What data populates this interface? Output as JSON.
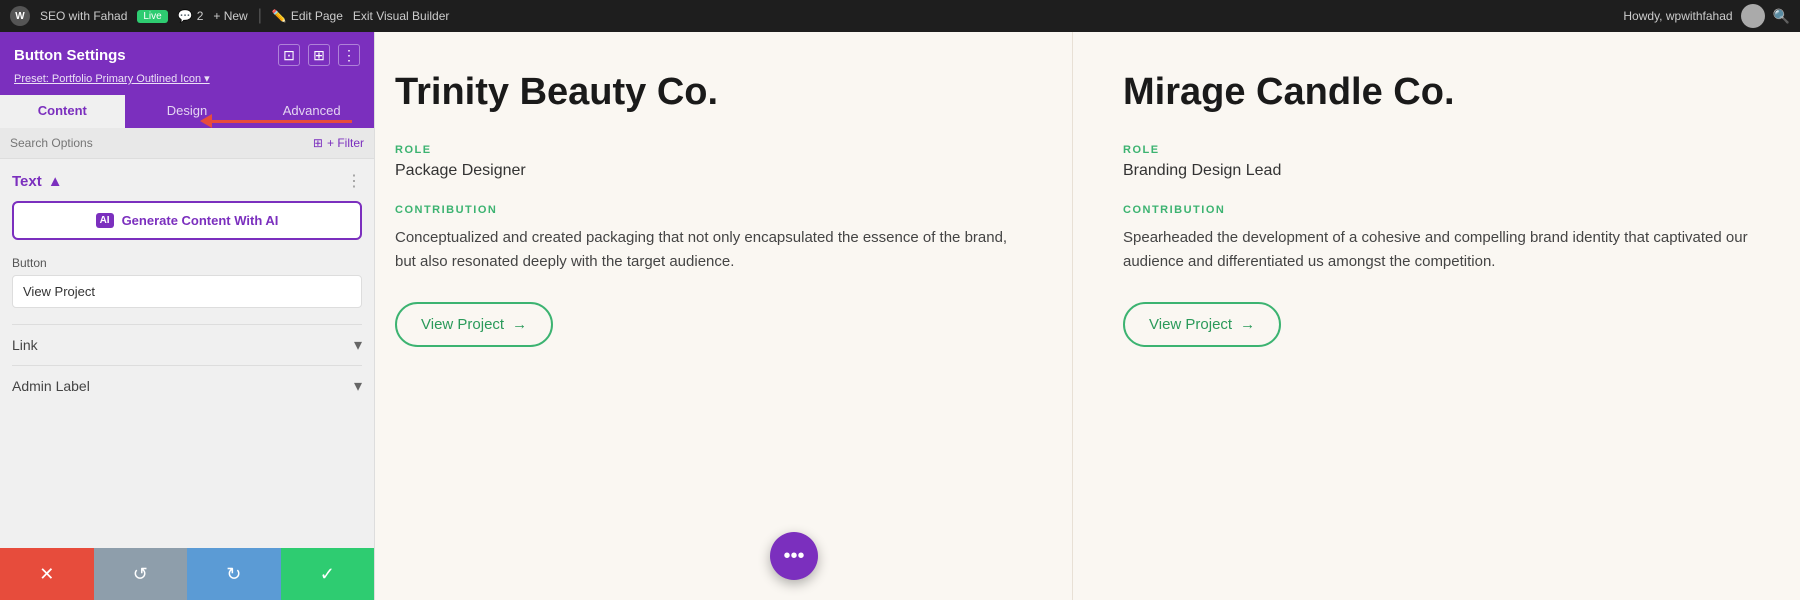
{
  "admin_bar": {
    "site_name": "SEO with Fahad",
    "live_badge": "Live",
    "comments_count": "2",
    "edit_page": "Edit Page",
    "exit_builder": "Exit Visual Builder",
    "new_label": "+ New",
    "user_greeting": "Howdy, wpwithfahad",
    "search_icon": "search-icon"
  },
  "panel": {
    "title": "Button Settings",
    "preset_label": "Preset: Portfolio Primary Outlined Icon ▾",
    "tabs": [
      "Content",
      "Design",
      "Advanced"
    ],
    "active_tab": "Content",
    "search_placeholder": "Search Options",
    "filter_label": "+ Filter",
    "text_section_title": "Text",
    "ai_button_label": "Generate Content With AI",
    "ai_badge": "AI",
    "button_section_label": "Button",
    "button_input_value": "View Project",
    "link_section": "Link",
    "admin_label_section": "Admin Label"
  },
  "bottom_bar": {
    "cancel_icon": "✕",
    "undo_icon": "↺",
    "redo_icon": "↻",
    "save_icon": "✓"
  },
  "cards": [
    {
      "title": "Trinity Beauty Co.",
      "role_label": "ROLE",
      "role_value": "Package Designer",
      "contribution_label": "CONTRIBUTION",
      "contribution_text": "Conceptualized and created packaging that not only encapsulated the essence of the brand, but also resonated deeply with the target audience.",
      "button_label": "View Project",
      "button_arrow": "→"
    },
    {
      "title": "Mirage Candle Co.",
      "role_label": "ROLE",
      "role_value": "Branding Design Lead",
      "contribution_label": "CONTRIBUTION",
      "contribution_text": "Spearheaded the development of a cohesive and compelling brand identity that captivated our audience and differentiated us amongst the competition.",
      "button_label": "View Project",
      "button_arrow": "→"
    }
  ],
  "fab": {
    "icon": "•••"
  }
}
